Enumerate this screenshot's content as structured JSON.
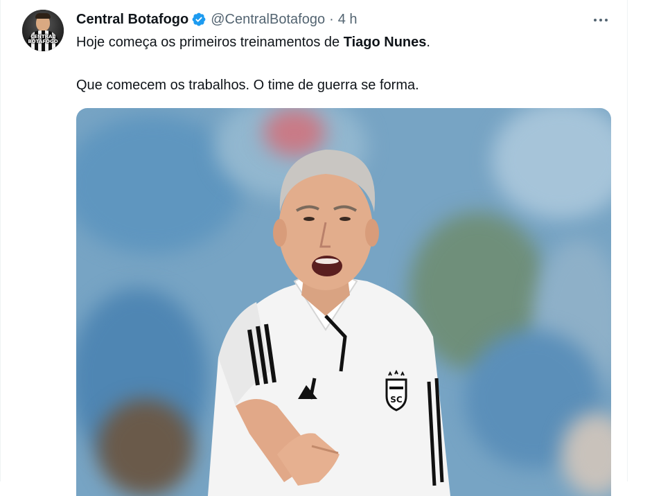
{
  "tweet": {
    "author_name": "Central Botafogo",
    "handle": "@CentralBotafogo",
    "separator": "·",
    "time": "4 h",
    "avatar_text": "CENTRAL BOTAFOGO",
    "text_line1_prefix": "Hoje começa os primeiros treinamentos de ",
    "text_line1_bold": "Tiago Nunes",
    "text_line1_suffix": ".",
    "text_line2": "Que comecem os trabalhos. O time de guerra se forma.",
    "media_crest_text": "SC",
    "media_description": "coach-in-white-polo-shouting"
  },
  "icons": {
    "verified": "verified-badge-icon",
    "more": "more-options-icon"
  },
  "colors": {
    "accent": "#1d9bf0",
    "secondary_text": "#536471",
    "primary_text": "#0f1419"
  }
}
